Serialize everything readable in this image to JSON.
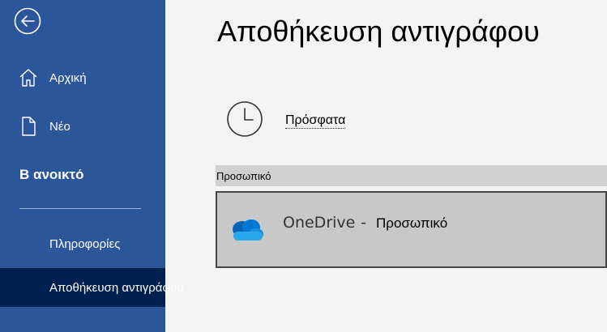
{
  "sidebar": {
    "back_icon": "back-arrow-icon",
    "home_label": "Αρχική",
    "home_icon": "home-icon",
    "new_label": "Νέο",
    "new_icon": "document-icon",
    "open_label": "Β ανοικτό",
    "info_label": "Πληροφορίες",
    "saveas_label": "Αποθήκευση αντιγράφου",
    "bg_color": "#2b579a",
    "selected_color": "#002050"
  },
  "main": {
    "title": "Αποθήκευση αντιγράφου",
    "recent_label": "Πρόσφατα",
    "recent_icon": "clock-icon",
    "section_label": "Προσωπικό",
    "onedrive": {
      "name": "OneDrive",
      "separator": "-",
      "kind": "Προσωπικό",
      "icon": "onedrive-cloud-icon"
    }
  }
}
